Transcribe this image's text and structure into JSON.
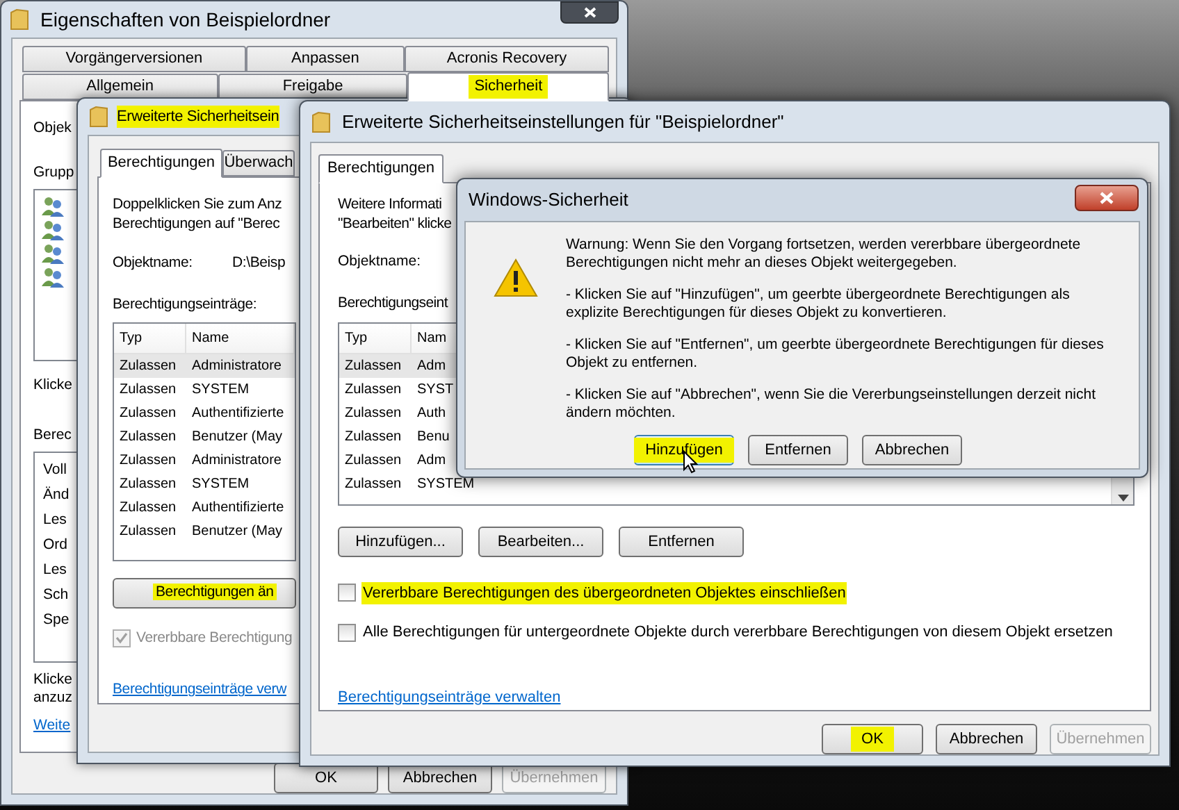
{
  "properties_window": {
    "title": "Eigenschaften von Beispielordner",
    "tab_rows": [
      [
        {
          "label": "Vorgängerversionen",
          "selected": false,
          "highlighted": false
        },
        {
          "label": "Anpassen",
          "selected": false,
          "highlighted": false
        },
        {
          "label": "Acronis Recovery",
          "selected": false,
          "highlighted": false
        }
      ],
      [
        {
          "label": "Allgemein",
          "selected": false,
          "highlighted": false
        },
        {
          "label": "Freigabe",
          "selected": false,
          "highlighted": false
        },
        {
          "label": "Sicherheit",
          "selected": true,
          "highlighted": true
        }
      ]
    ],
    "object_label": "Objek",
    "groups_label": "Grupp",
    "hint_1": "Klicke",
    "permissions_label": "Berec",
    "permissions": [
      "Voll",
      "Änd",
      "Les",
      "Ord",
      "Les",
      "Sch",
      "Spe"
    ],
    "hint_2_lines": [
      "Klicke",
      "anzuz"
    ],
    "link": "Weite",
    "buttons": [
      {
        "label": "OK",
        "disabled": false
      },
      {
        "label": "Abbrechen",
        "disabled": false
      },
      {
        "label": "Übernehmen",
        "disabled": true
      }
    ]
  },
  "advanced_window_back": {
    "title": "Erweiterte Sicherheitsein",
    "title_highlighted": true,
    "tabs": [
      {
        "label": "Berechtigungen",
        "selected": true
      },
      {
        "label": "Überwach",
        "selected": false
      }
    ],
    "intro_lines": [
      "Doppelklicken Sie zum Anz",
      "Berechtigungen auf \"Berec"
    ],
    "object_label": "Objektname:",
    "object_value": "D:\\Beisp",
    "entries_label": "Berechtigungseinträge:",
    "columns": [
      "Typ",
      "Name"
    ],
    "rows": [
      {
        "type": "Zulassen",
        "name": "Administratore",
        "selected": true
      },
      {
        "type": "Zulassen",
        "name": "SYSTEM",
        "selected": false
      },
      {
        "type": "Zulassen",
        "name": "Authentifizierte",
        "selected": false
      },
      {
        "type": "Zulassen",
        "name": "Benutzer (May",
        "selected": false
      },
      {
        "type": "Zulassen",
        "name": "Administratore",
        "selected": false
      },
      {
        "type": "Zulassen",
        "name": "SYSTEM",
        "selected": false
      },
      {
        "type": "Zulassen",
        "name": "Authentifizierte",
        "selected": false
      },
      {
        "type": "Zulassen",
        "name": "Benutzer (May",
        "selected": false
      }
    ],
    "change_button": {
      "label": "Berechtigungen än",
      "highlighted": true
    },
    "inherit_checkbox": {
      "label": "Vererbbare Berechtigung",
      "checked": true,
      "disabled": true
    },
    "link": "Berechtigungseinträge verw"
  },
  "advanced_window_front": {
    "title": "Erweiterte Sicherheitseinstellungen für \"Beispielordner\"",
    "tabs": [
      {
        "label": "Berechtigungen",
        "selected": true
      }
    ],
    "intro_lines": [
      "Weitere Informati",
      "\"Bearbeiten\" klicke"
    ],
    "object_label": "Objektname:",
    "entries_label": "Berechtigungseint",
    "columns": [
      "Typ",
      "Nam"
    ],
    "rows": [
      {
        "type": "Zulassen",
        "name": "Adm",
        "selected": true
      },
      {
        "type": "Zulassen",
        "name": "SYST",
        "selected": false
      },
      {
        "type": "Zulassen",
        "name": "Auth",
        "selected": false
      },
      {
        "type": "Zulassen",
        "name": "Benu",
        "selected": false
      },
      {
        "type": "Zulassen",
        "name": "Adm",
        "selected": false
      },
      {
        "type": "Zulassen",
        "name": "SYSTEM",
        "selected": false
      }
    ],
    "buttons": [
      {
        "label": "Hinzufügen...",
        "disabled": false
      },
      {
        "label": "Bearbeiten...",
        "disabled": false
      },
      {
        "label": "Entfernen",
        "disabled": false
      }
    ],
    "checkboxes": [
      {
        "label": "Vererbbare Berechtigungen des übergeordneten Objektes einschließen",
        "checked": false,
        "highlighted": true
      },
      {
        "label": "Alle Berechtigungen für untergeordnete Objekte durch vererbbare Berechtigungen von diesem Objekt ersetzen",
        "checked": false,
        "highlighted": false
      }
    ],
    "link": "Berechtigungseinträge verwalten",
    "footer_buttons": [
      {
        "label": "OK",
        "disabled": false,
        "highlighted": true
      },
      {
        "label": "Abbrechen",
        "disabled": false,
        "highlighted": false
      },
      {
        "label": "Übernehmen",
        "disabled": true,
        "highlighted": false
      }
    ]
  },
  "security_dialog": {
    "title": "Windows-Sicherheit",
    "paragraphs": [
      "Warnung: Wenn Sie den Vorgang fortsetzen, werden vererbbare übergeordnete Berechtigungen nicht mehr an dieses Objekt weitergegeben.",
      "- Klicken Sie auf \"Hinzufügen\", um geerbte übergeordnete Berechtigungen als explizite Berechtigungen für dieses Objekt zu konvertieren.",
      "- Klicken Sie auf \"Entfernen\", um geerbte übergeordnete Berechtigungen für dieses Objekt zu entfernen.",
      "- Klicken Sie auf \"Abbrechen\", wenn Sie die Vererbungseinstellungen derzeit nicht ändern möchten."
    ],
    "buttons": [
      {
        "label": "Hinzufügen",
        "focused": true,
        "highlighted": true
      },
      {
        "label": "Entfernen",
        "focused": false,
        "highlighted": false
      },
      {
        "label": "Abbrechen",
        "focused": false,
        "highlighted": false
      }
    ]
  }
}
